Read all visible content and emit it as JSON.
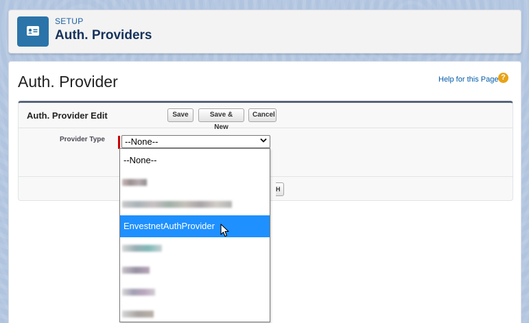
{
  "header": {
    "setup_label": "SETUP",
    "title": "Auth. Providers",
    "icon": "id-card-icon"
  },
  "page": {
    "section_title": "Auth. Provider",
    "help_link": "Help for this Page",
    "help_icon": "?"
  },
  "edit_panel": {
    "title": "Auth. Provider Edit",
    "buttons": {
      "save": "Save",
      "save_new": "Save & New",
      "cancel": "Cancel"
    },
    "field_label": "Provider Type",
    "select_value": "--None--",
    "partial_button_text": "H"
  },
  "dropdown": {
    "options": [
      "--None--",
      "EnvestnetAuthProvider"
    ],
    "selected": "EnvestnetAuthProvider"
  },
  "colors": {
    "brand_icon": "#2a74a9",
    "title": "#16325c",
    "link": "#015ba7",
    "highlight": "#1e90ff",
    "required": "#cc0000"
  }
}
